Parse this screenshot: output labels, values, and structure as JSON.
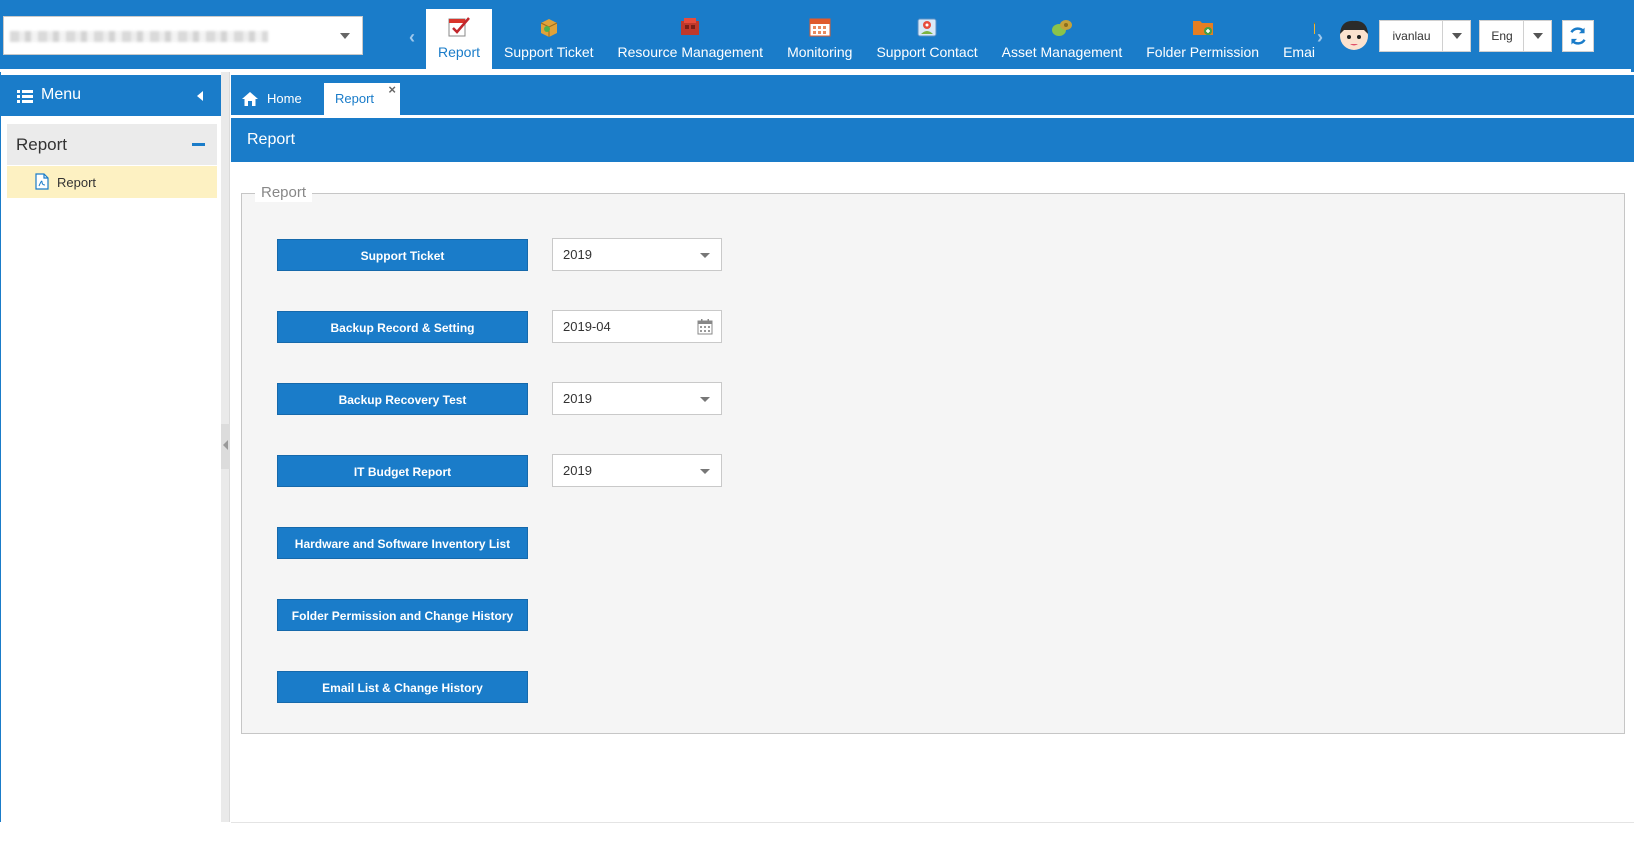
{
  "header": {
    "company_select_value": "",
    "modules": [
      {
        "label": "Report",
        "icon": "report-icon",
        "active": true
      },
      {
        "label": "Support Ticket",
        "icon": "support-ticket-icon",
        "active": false
      },
      {
        "label": "Resource Management",
        "icon": "resource-management-icon",
        "active": false
      },
      {
        "label": "Monitoring",
        "icon": "monitoring-icon",
        "active": false
      },
      {
        "label": "Support Contact",
        "icon": "support-contact-icon",
        "active": false
      },
      {
        "label": "Asset Management",
        "icon": "asset-management-icon",
        "active": false
      },
      {
        "label": "Folder Permission",
        "icon": "folder-permission-icon",
        "active": false
      },
      {
        "label": "Email Manag",
        "icon": "email-management-icon",
        "active": false
      }
    ],
    "user": "ivanlau",
    "language": "Eng"
  },
  "sidebar": {
    "title": "Menu",
    "group": "Report",
    "items": [
      {
        "label": "Report"
      }
    ]
  },
  "tabs": [
    {
      "label": "Home"
    },
    {
      "label": "Report"
    }
  ],
  "tab_close_glyph": "×",
  "page": {
    "title": "Report",
    "section_legend": "Report",
    "reports": [
      {
        "label": "Support Ticket",
        "selector": "2019",
        "selector_type": "select"
      },
      {
        "label": "Backup Record & Setting",
        "selector": "2019-04",
        "selector_type": "date"
      },
      {
        "label": "Backup Recovery Test",
        "selector": "2019",
        "selector_type": "select"
      },
      {
        "label": "IT Budget Report",
        "selector": "2019",
        "selector_type": "select"
      },
      {
        "label": "Hardware and Software Inventory List"
      },
      {
        "label": "Folder Permission and Change History"
      },
      {
        "label": "Email List & Change History"
      }
    ]
  },
  "colors": {
    "primary": "#1a7cc9",
    "selected_item": "#fdf1c2",
    "panel_bg": "#f5f5f5"
  }
}
